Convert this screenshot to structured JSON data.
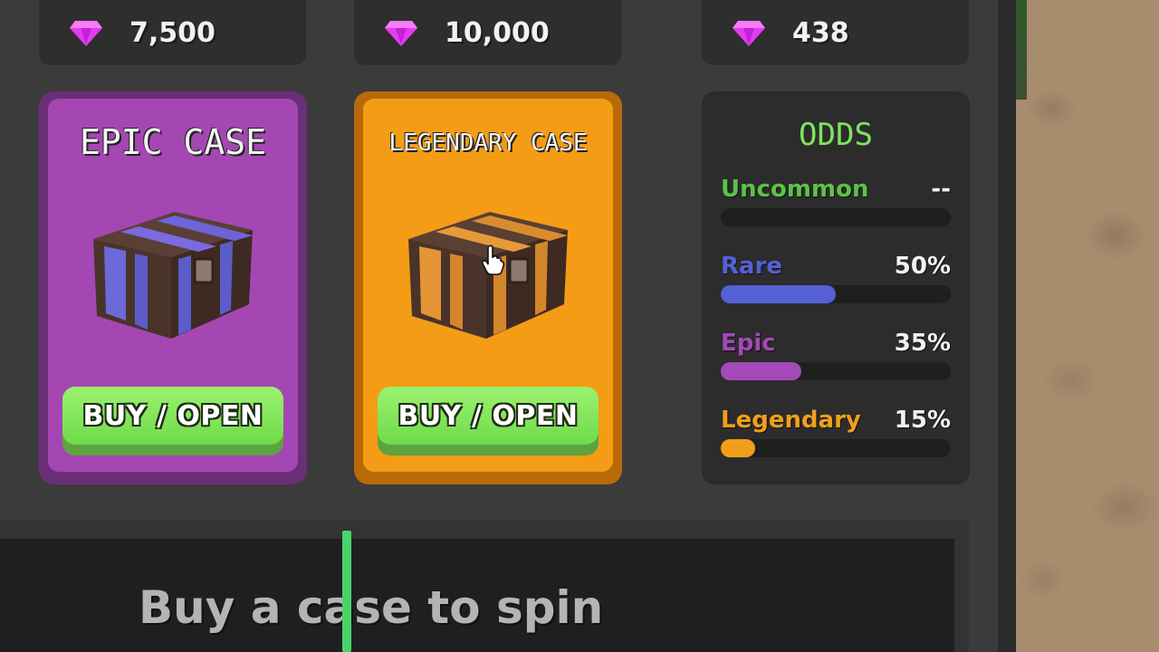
{
  "prices": [
    {
      "amount": "7,500"
    },
    {
      "amount": "10,000"
    },
    {
      "amount": "438"
    }
  ],
  "cases": [
    {
      "title": "EPIC CASE",
      "button_label": "BUY / OPEN"
    },
    {
      "title": "LEGENDARY CASE",
      "button_label": "BUY / OPEN"
    }
  ],
  "odds": {
    "heading": "ODDS",
    "rows": [
      {
        "name": "Uncommon",
        "percent": "--",
        "fill": 0,
        "color": "#5cc247"
      },
      {
        "name": "Rare",
        "percent": "50%",
        "fill": 0.5,
        "color": "#5560d6"
      },
      {
        "name": "Epic",
        "percent": "35%",
        "fill": 0.35,
        "color": "#a449b8"
      },
      {
        "name": "Legendary",
        "percent": "15%",
        "fill": 0.15,
        "color": "#f19f1b"
      }
    ]
  },
  "spinner": {
    "message": "Buy a case to spin"
  },
  "colors": {
    "gem": "#e23cf0",
    "epic_border": "#6a2f78",
    "epic_inner": "#a447b2",
    "legendary_border": "#b86a0a",
    "legendary_inner": "#f49c16",
    "button_green": "#7fe35a"
  }
}
